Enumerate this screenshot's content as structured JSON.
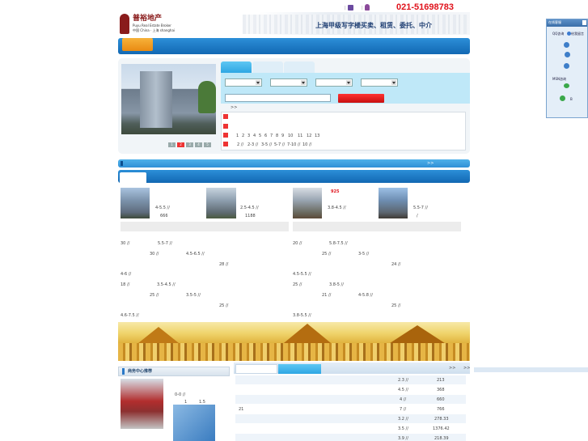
{
  "header": {
    "logo_cn": "普裕地产",
    "logo_en": "Puyu Real Estate Broker",
    "logo_loc": "中国 China · 上海 shanghai",
    "phone": "021-51698783",
    "sep1": "|",
    "sep2": "|",
    "slogan": "上海甲级写字楼买卖、租赁、委托、中介"
  },
  "search": {
    "more": ">>",
    "pages": [
      "1",
      "2",
      "3",
      "4",
      "5",
      "6",
      "7",
      "8",
      "9",
      "10",
      "11",
      "12",
      "13"
    ],
    "ranges": [
      "2 //",
      "2-3 //",
      "3-5 //",
      "5-7 //",
      "7-10 //",
      "10 //"
    ],
    "slides": [
      "1",
      "2",
      "3",
      "4",
      "5"
    ],
    "bar_more": ">>"
  },
  "featured": [
    {
      "price": "4-5.5 //",
      "area": "666"
    },
    {
      "price": "2.5-4.5 //",
      "area": "1188"
    },
    {
      "price": "3.8-4.5 //",
      "badge": "925"
    },
    {
      "price": "5.5-7 //",
      "area": "/"
    }
  ],
  "left_list": {
    "rows": [
      {
        "c1": "30 //",
        "c2": "5.5-7 //"
      },
      {
        "c1": "30 //",
        "c2": "4.5-6.5 //"
      },
      {
        "c1": "28 //"
      },
      {
        "c1": "4-6 //"
      },
      {
        "c1": "18 //",
        "c2": "3.5-4.5 //"
      },
      {
        "c1": "25 //",
        "c2": "3.5-5 //"
      },
      {
        "c1": "25 //"
      },
      {
        "c1": "4.6-7.5 //"
      }
    ]
  },
  "right_list": {
    "rows": [
      {
        "c1": "20 //",
        "c2": "5.8-7.5 //"
      },
      {
        "c1": "25 //",
        "c2": "3-5 //"
      },
      {
        "c1": "24 //"
      },
      {
        "c1": "4.5-5.5 //"
      },
      {
        "c1": "25 //",
        "c2": "3.8-5 //"
      },
      {
        "c1": "21 //",
        "c2": "4-5.8 //"
      },
      {
        "c1": "25 //"
      },
      {
        "c1": "3.8-5.5 //"
      }
    ]
  },
  "business_center": {
    "title": "商务中心推荐",
    "price": "0-0 //",
    "n1": "1",
    "n2": "1.5"
  },
  "table": {
    "more1": ">>",
    "more2": ">>",
    "rows": [
      {
        "a": "",
        "b": "2.3 //",
        "c": "213"
      },
      {
        "a": "",
        "b": "4.5 //",
        "c": "368"
      },
      {
        "a": "",
        "b": "4 //",
        "c": "660"
      },
      {
        "a": "21",
        "b": "7 //",
        "c": "766"
      },
      {
        "a": "",
        "b": "3.2 //",
        "c": "278.33"
      },
      {
        "a": "",
        "b": "3.5 //",
        "c": "1376.42"
      },
      {
        "a": "",
        "b": "3.9 //",
        "c": "218.39"
      }
    ]
  },
  "side": {
    "title": "在线客服",
    "qq": "QQ咨询",
    "leave_msg": "给我留言",
    "msn": "MSN咨询",
    "b": "B"
  },
  "colors": {
    "accent_blue": "#1a7fd0",
    "phone_red": "#e0121b",
    "search_red": "#e51b1b",
    "orange_tab": "#f29b20"
  }
}
